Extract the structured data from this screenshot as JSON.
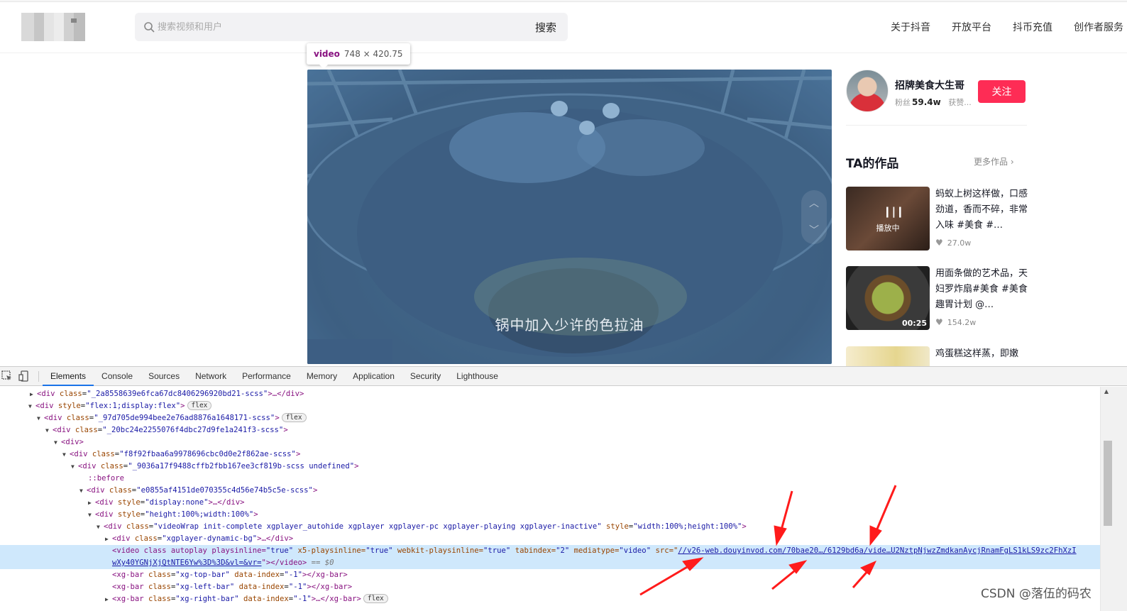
{
  "header": {
    "search_placeholder": "搜索视频和用户",
    "search_button": "搜索",
    "nav": [
      "关于抖音",
      "开放平台",
      "抖币充值",
      "创作者服务"
    ]
  },
  "inspector_tooltip": {
    "tag": "video",
    "dimensions": "748 × 420.75"
  },
  "video": {
    "subtitle": "锅中加入少许的色拉油"
  },
  "author": {
    "name": "招牌美食大生哥",
    "fans_label": "粉丝",
    "fans_count": "59.4w",
    "likes_label": "获赞...",
    "follow_button": "关注"
  },
  "works": {
    "title": "TA的作品",
    "more_label": "更多作品 ›",
    "items": [
      {
        "title": "蚂蚁上树这样做，口感劲道，香而不碎，非常入味 #美食 #…",
        "likes": "27.0w",
        "overlay": "播放中"
      },
      {
        "title": "用面条做的艺术品，天妇罗炸扇#美食 #美食趣胃计划 @…",
        "likes": "154.2w",
        "duration": "00:25"
      },
      {
        "title": "鸡蛋糕这样蒸，即嫩",
        "likes": ""
      }
    ]
  },
  "devtools": {
    "tabs": [
      "Elements",
      "Console",
      "Sources",
      "Network",
      "Performance",
      "Memory",
      "Application",
      "Security",
      "Lighthouse"
    ],
    "active_tab": "Elements",
    "tree": {
      "l1": {
        "tag": "<div",
        "attr": "class",
        "val": "\"_2a8558639e6fca67dc8406296920bd21-scss\"",
        "tail": ">…</div>"
      },
      "l2": {
        "tag": "<div",
        "attr": "style",
        "val": "\"flex:1;display:flex\"",
        "close": ">",
        "pill": "flex"
      },
      "l3": {
        "tag": "<div",
        "attr": "class",
        "val": "\"_97d705de994bee2e76ad8876a1648171-scss\"",
        "close": ">",
        "pill": "flex"
      },
      "l4": {
        "tag": "<div",
        "attr": "class",
        "val": "\"_20bc24e2255076f4dbc27d9fe1a241f3-scss\"",
        "close": ">"
      },
      "l5": {
        "tag": "<div>"
      },
      "l6": {
        "tag": "<div",
        "attr": "class",
        "val": "\"f8f92fbaa6a9978696cbc0d0e2f862ae-scss\"",
        "close": ">"
      },
      "l7": {
        "tag": "<div",
        "attr": "class",
        "val": "\"_9036a17f9488cffb2fbb167ee3cf819b-scss undefined\"",
        "close": ">"
      },
      "l8": {
        "text": "::before"
      },
      "l9": {
        "tag": "<div",
        "attr": "class",
        "val": "\"e0855af4151de070355c4d56e74b5c5e-scss\"",
        "close": ">"
      },
      "l10": {
        "tag": "<div",
        "attr": "style",
        "val": "\"display:none\"",
        "tail": ">…</div>"
      },
      "l11": {
        "tag": "<div",
        "attr": "style",
        "val": "\"height:100%;width:100%\"",
        "close": ">"
      },
      "l12": {
        "tag": "<div",
        "attr": "class",
        "val": "\"videoWrap init-complete xgplayer_autohide xgplayer xgplayer-pc xgplayer-playing xgplayer-inactive\"",
        "attr2": "style",
        "val2": "\"width:100%;height:100%\"",
        "close": ">"
      },
      "l13": {
        "tag": "<div",
        "attr": "class",
        "val": "\"xgplayer-dynamic-bg\"",
        "tail": ">…</div>"
      },
      "l14": {
        "pre": "<video class autoplay playsinline=",
        "v1": "\"true\"",
        "a2": " x5-playsinline=",
        "v2": "\"true\"",
        "a3": " webkit-playsinline=",
        "v3": "\"true\"",
        "a4": " tabindex=",
        "v4": "\"2\"",
        "a5": " mediatype=",
        "v5": "\"video\"",
        "a6": " src=\"",
        "link1": "//v26-web.douyinvod.com/70bae20…/6129bd6a/vide…U2NztpNjwzZmdkanAycjRnamFgLS1kLS9zc2FhXzI",
        "link2": "wXy40YGNjXjQtNTE6Yw%3D%3D&vl=&vr=",
        "tail2": "\"></video>",
        "eq": " == $0"
      },
      "l15": {
        "tag": "<xg-bar",
        "attr": "class",
        "val": "\"xg-top-bar\"",
        "attr2": "data-index",
        "val2": "\"-1\"",
        "tail": "></xg-bar>"
      },
      "l16": {
        "tag": "<xg-bar",
        "attr": "class",
        "val": "\"xg-left-bar\"",
        "attr2": "data-index",
        "val2": "\"-1\"",
        "tail": "></xg-bar>"
      },
      "l17": {
        "tag": "<xg-bar",
        "attr": "class",
        "val": "\"xg-right-bar\"",
        "attr2": "data-index",
        "val2": "\"-1\"",
        "tail": ">…</xg-bar>",
        "pill": "flex"
      }
    }
  },
  "watermark": "CSDN @落伍的码农"
}
